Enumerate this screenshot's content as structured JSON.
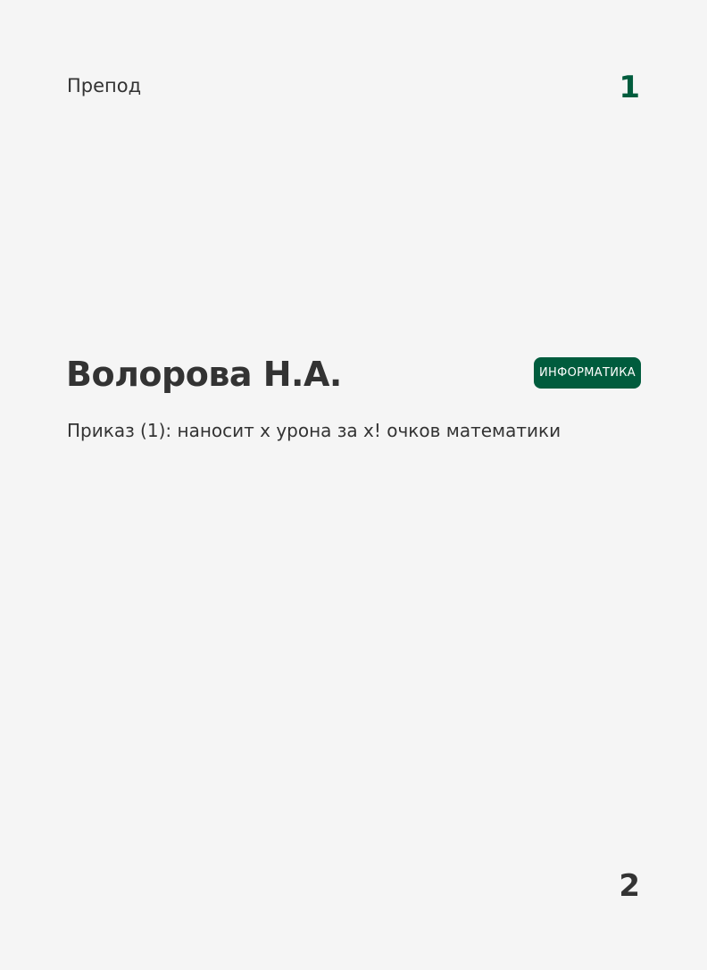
{
  "card": {
    "type": "Препод",
    "cost": "1",
    "name": "Волорова Н.А.",
    "subject_badge": "ИНФОРМАТИКА",
    "description": "Приказ (1): наносит x урона за x! очков математики",
    "power": "2"
  },
  "colors": {
    "accent": "#005c3d",
    "background": "#f5f5f5",
    "text": "#333333"
  }
}
